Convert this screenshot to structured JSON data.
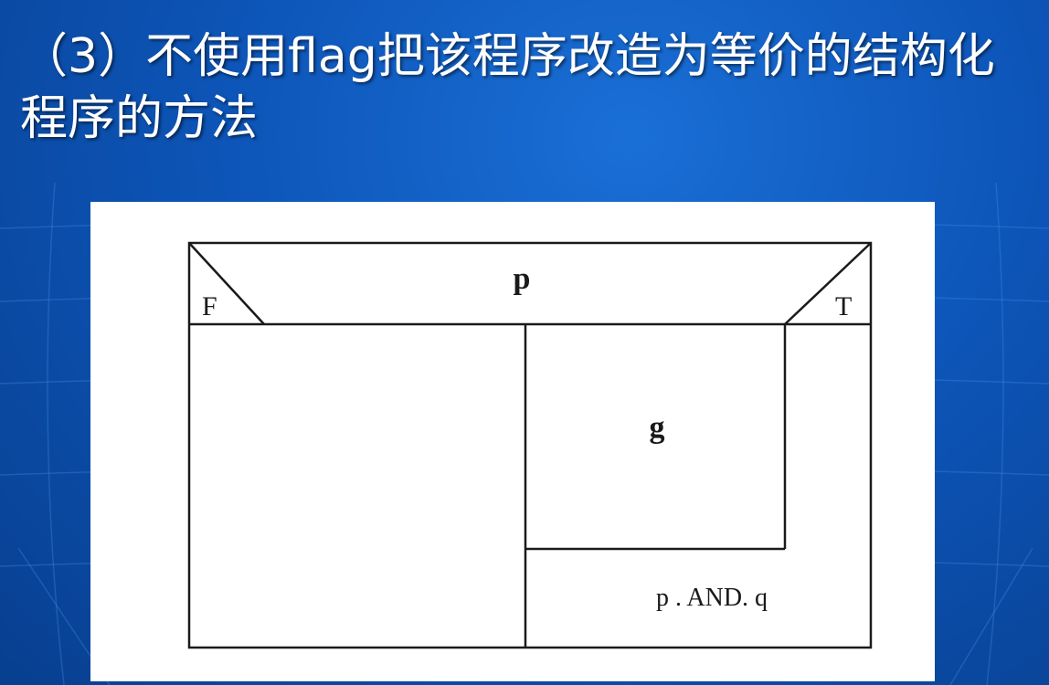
{
  "slide": {
    "title": "（3）不使用flag把该程序改造为等价的结构化程序的方法"
  },
  "diagram": {
    "condition_label": "p",
    "false_label": "F",
    "true_label": "T",
    "inner_block_label": "g",
    "loop_condition_label": "p . AND. q"
  }
}
